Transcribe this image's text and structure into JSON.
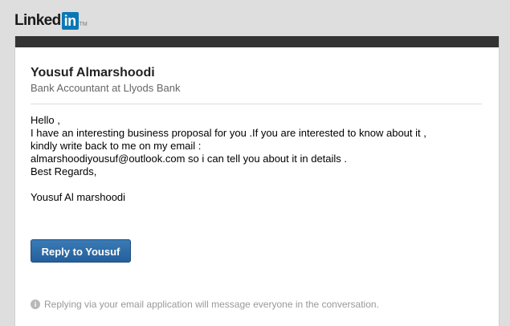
{
  "brand": {
    "logo_text_linked": "Linked",
    "logo_text_in": "in",
    "logo_tm": "TM",
    "accent_color": "#0a77b5"
  },
  "sender": {
    "name": "Yousuf Almarshoodi",
    "title": "Bank Accountant at Llyods Bank"
  },
  "message": {
    "lines": [
      "Hello ,",
      "I have an interesting business proposal for you .If you are interested to know about it ,",
      "kindly write back to me on my email :",
      "almarshoodiyousuf@outlook.com so i can tell you about it in details .",
      "Best Regards,"
    ],
    "signature": "Yousuf Al marshoodi"
  },
  "actions": {
    "reply_label": "Reply to Yousuf",
    "reply_color": "#2b6aa6"
  },
  "footer": {
    "info_icon": "info-icon",
    "note": "Replying via your email application will message everyone in the conversation."
  }
}
